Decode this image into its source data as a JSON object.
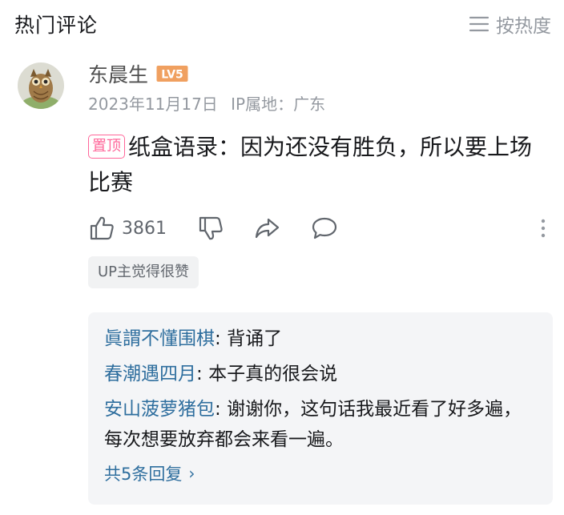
{
  "header": {
    "title": "热门评论",
    "sort_label": "按热度",
    "sort_icon": "list-lines-icon"
  },
  "comment": {
    "username": "东晨生",
    "level": "LV5",
    "date": "2023年11月17日",
    "ip_location": "IP属地：广东",
    "pin_label": "置顶",
    "text": "纸盒语录：因为还没有胜负，所以要上场比赛",
    "like_count": "3861",
    "up_tag": "UP主觉得很赞"
  },
  "replies": [
    {
      "name": "眞謂不懂围棋",
      "sep": ": ",
      "text": "背诵了"
    },
    {
      "name": "春潮遇四月",
      "sep": ": ",
      "text": "本子真的很会说"
    },
    {
      "name": "安山菠萝猪包",
      "sep": ": ",
      "text": "谢谢你，这句话我最近看了好多遍，每次想要放弃都会来看一遍。"
    }
  ],
  "view_all_label": "共5条回复",
  "colors": {
    "link_blue": "#2e6e9e",
    "pin_pink": "#ff6699",
    "level_orange": "#f0a060",
    "muted_gray": "#9499a0"
  }
}
